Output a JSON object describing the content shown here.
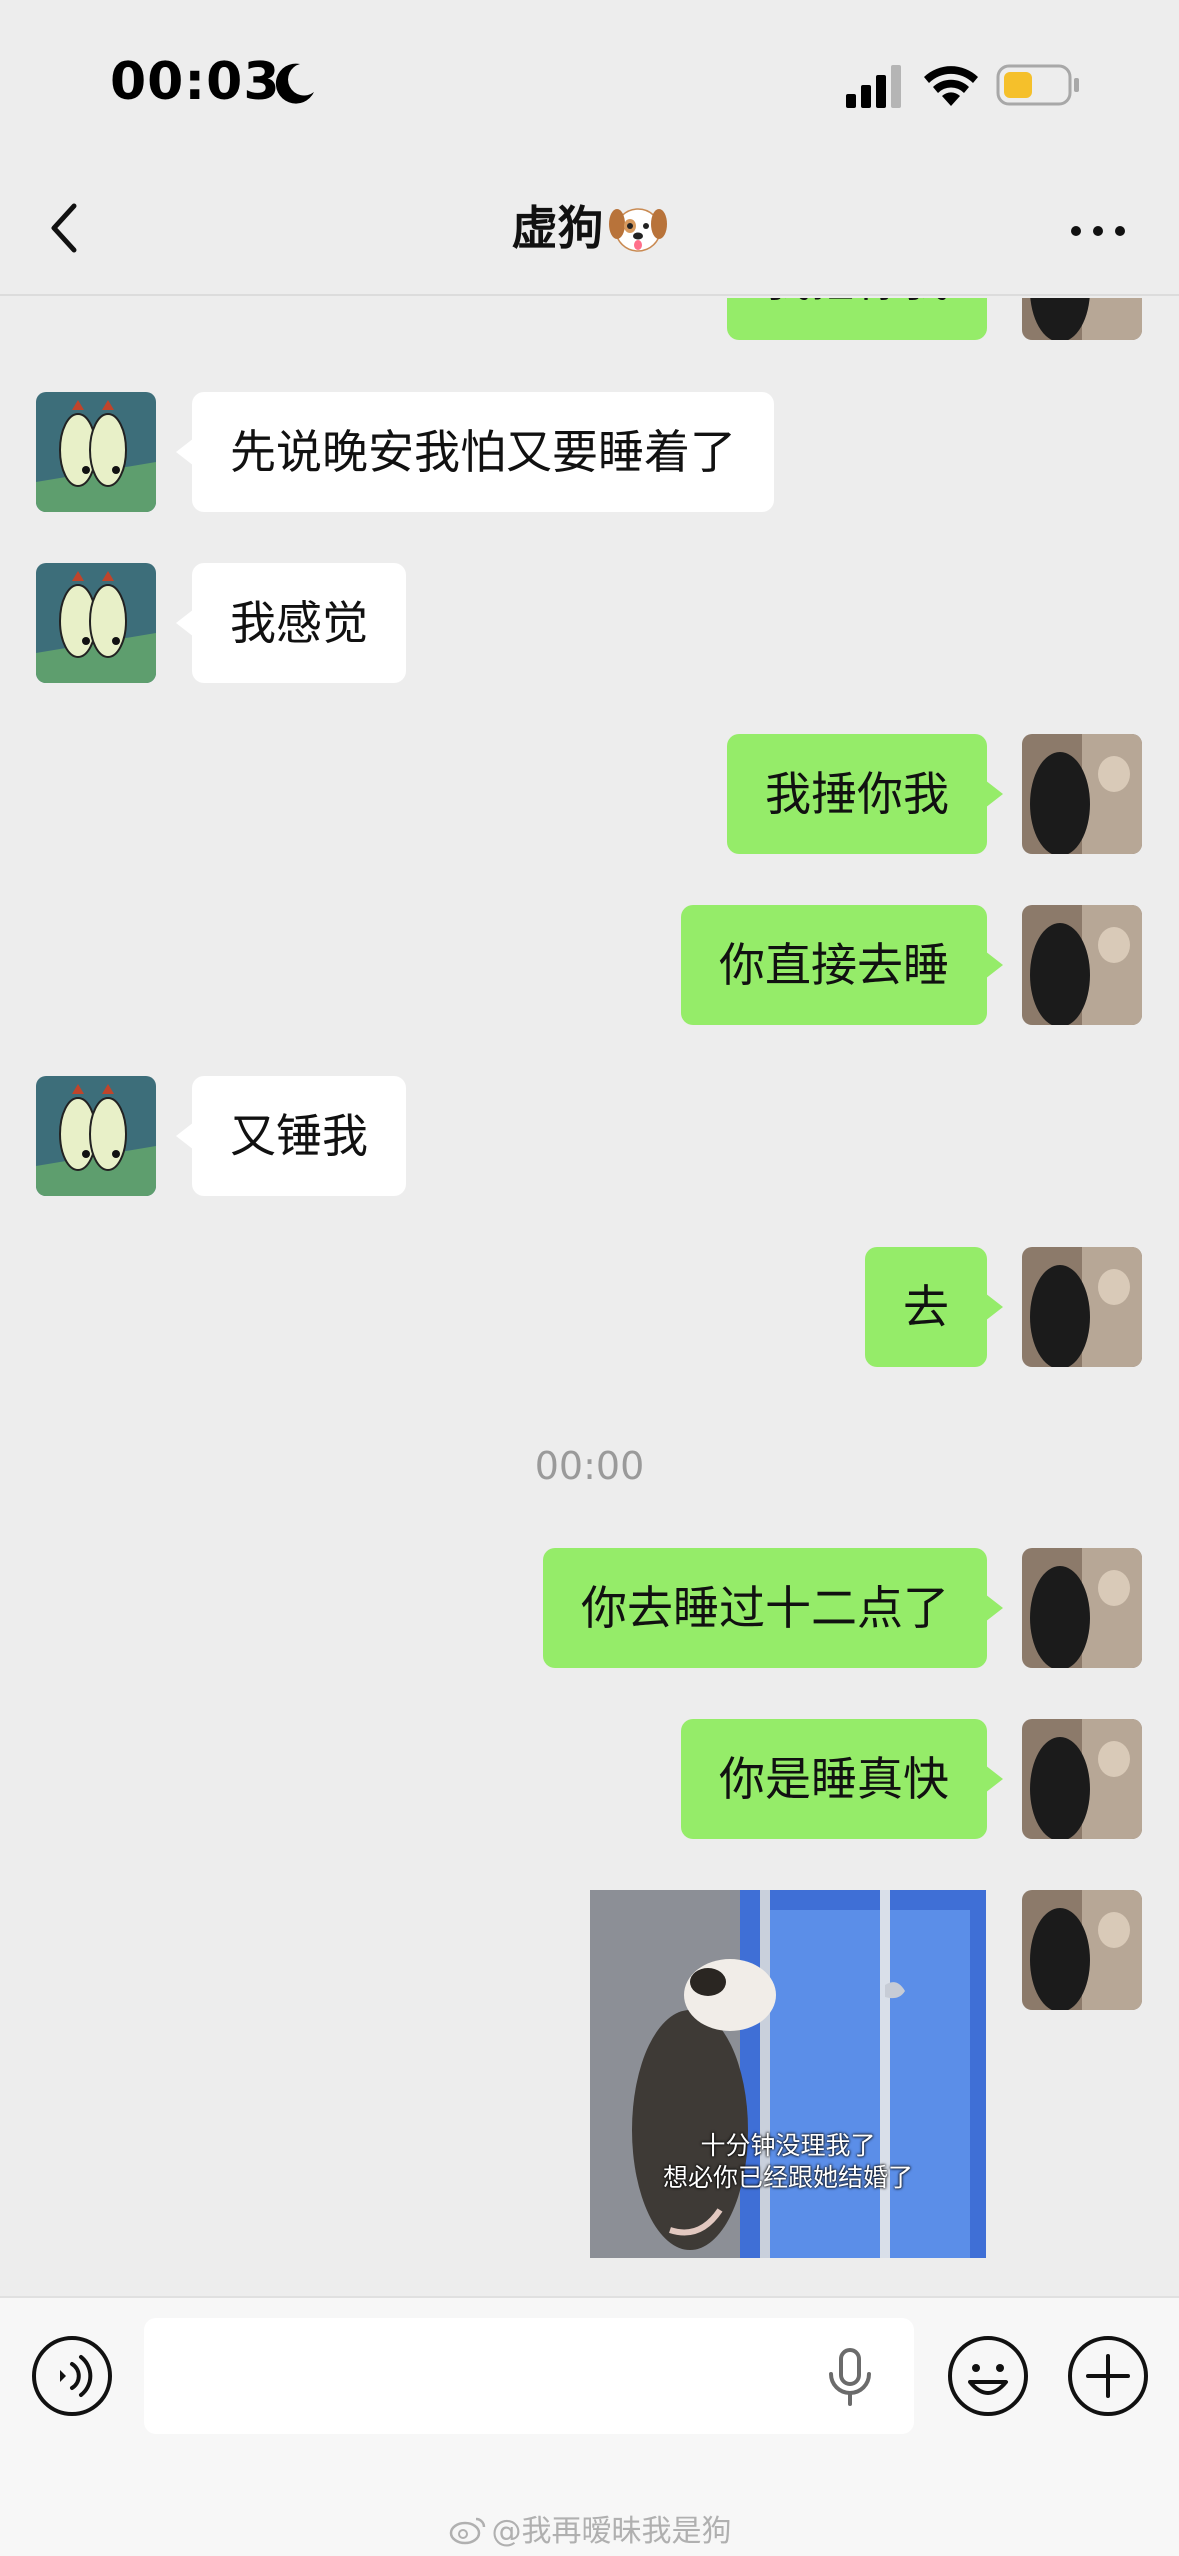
{
  "status_bar": {
    "time": "00:03",
    "icons": [
      "moon-icon",
      "signal-icon",
      "wifi-icon",
      "battery-icon"
    ]
  },
  "nav": {
    "title": "虚狗",
    "title_icon": "dog-face-icon",
    "back_icon": "chevron-left-icon",
    "more_icon": "more-dots-icon"
  },
  "messages": [
    {
      "side": "right",
      "text": "我捶你我",
      "partial": true
    },
    {
      "side": "left",
      "text": "先说晚安我怕又要睡着了"
    },
    {
      "side": "left",
      "text": "我感觉"
    },
    {
      "side": "right",
      "text": "我捶你我"
    },
    {
      "side": "right",
      "text": "你直接去睡"
    },
    {
      "side": "left",
      "text": "又锤我"
    },
    {
      "side": "right",
      "text": "去"
    },
    {
      "timestamp": "00:00"
    },
    {
      "side": "right",
      "text": "你去睡过十二点了"
    },
    {
      "side": "right",
      "text": "你是睡真快"
    },
    {
      "side": "right",
      "sticker": true,
      "caption_lines": [
        "十分钟没理我了",
        "想必你已经跟她结婚了"
      ]
    }
  ],
  "input_bar": {
    "voice_icon": "voice-wave-icon",
    "placeholder": "",
    "mic_icon": "microphone-icon",
    "emoji_icon": "smiley-icon",
    "plus_icon": "plus-circle-icon"
  },
  "watermark": "@我再暧昧我是狗",
  "colors": {
    "background": "#ededed",
    "sent_bubble": "#95ec69",
    "received_bubble": "#ffffff",
    "timestamp": "#9a9a9a"
  }
}
